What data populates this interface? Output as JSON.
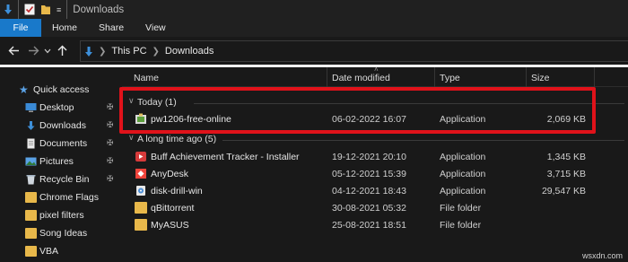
{
  "window": {
    "title": "Downloads"
  },
  "ribbon": {
    "tabs": [
      "File",
      "Home",
      "Share",
      "View"
    ]
  },
  "address": {
    "crumbs": [
      "This PC",
      "Downloads"
    ]
  },
  "nav": {
    "quick_access": "Quick access",
    "items": [
      {
        "label": "Desktop",
        "icon": "desktop-icon",
        "pinned": true
      },
      {
        "label": "Downloads",
        "icon": "downloads-icon",
        "pinned": true
      },
      {
        "label": "Documents",
        "icon": "documents-icon",
        "pinned": true
      },
      {
        "label": "Pictures",
        "icon": "pictures-icon",
        "pinned": true
      },
      {
        "label": "Recycle Bin",
        "icon": "recycle-bin-icon",
        "pinned": true
      },
      {
        "label": "Chrome Flags",
        "icon": "folder-icon",
        "pinned": false
      },
      {
        "label": "pixel filters",
        "icon": "folder-icon",
        "pinned": false
      },
      {
        "label": "Song Ideas",
        "icon": "folder-icon",
        "pinned": false
      },
      {
        "label": "VBA",
        "icon": "folder-icon",
        "pinned": false
      }
    ]
  },
  "columns": {
    "name": "Name",
    "date": "Date modified",
    "type": "Type",
    "size": "Size"
  },
  "groups": [
    {
      "label": "Today (1)",
      "files": [
        {
          "name": "pw1206-free-online",
          "date": "06-02-2022 16:07",
          "type": "Application",
          "size": "2,069 KB",
          "icon": "installer-icon"
        }
      ]
    },
    {
      "label": "A long time ago (5)",
      "files": [
        {
          "name": "Buff Achievement Tracker - Installer",
          "date": "19-12-2021 20:10",
          "type": "Application",
          "size": "1,345 KB",
          "icon": "buff-app-icon"
        },
        {
          "name": "AnyDesk",
          "date": "05-12-2021 15:39",
          "type": "Application",
          "size": "3,715 KB",
          "icon": "anydesk-icon"
        },
        {
          "name": "disk-drill-win",
          "date": "04-12-2021 18:43",
          "type": "Application",
          "size": "29,547 KB",
          "icon": "disk-drill-icon"
        },
        {
          "name": "qBittorrent",
          "date": "30-08-2021 05:32",
          "type": "File folder",
          "size": "",
          "icon": "folder-icon"
        },
        {
          "name": "MyASUS",
          "date": "25-08-2021 18:51",
          "type": "File folder",
          "size": "",
          "icon": "folder-icon"
        }
      ]
    }
  ],
  "watermark": "wsxdn.com",
  "colors": {
    "accent": "#1979ca",
    "highlight": "#e0121a",
    "folder": "#e8b84a"
  }
}
